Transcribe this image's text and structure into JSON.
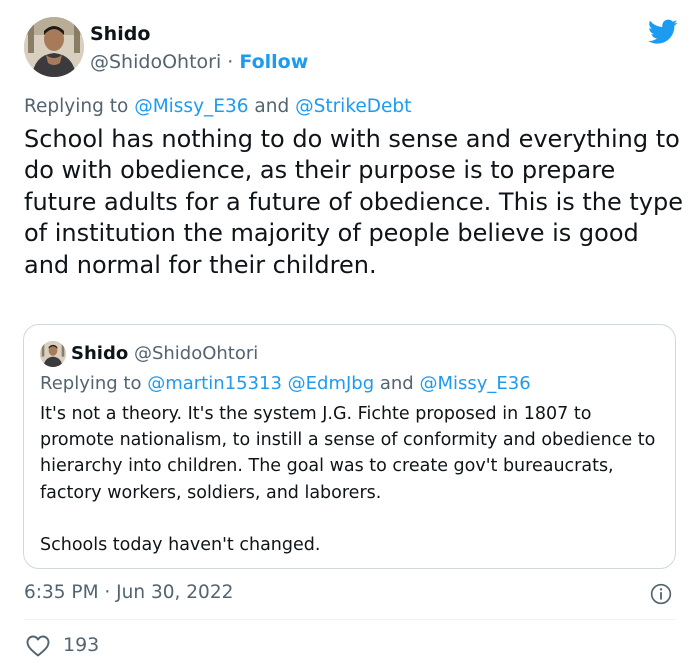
{
  "author": {
    "name": "Shido",
    "handle": "@ShidoOhtori",
    "separator": " · ",
    "follow_label": "Follow"
  },
  "reply": {
    "prefix": "Replying to ",
    "mention1": "@Missy_E36",
    "conjunction": " and ",
    "mention2": "@StrikeDebt"
  },
  "tweet": {
    "text": "School has nothing to do with sense and everything to do with obedience, as their purpose is to prepare future adults for a future of obedience. This is the type of institution the majority of people believe is good and normal for their children."
  },
  "quote": {
    "name": "Shido",
    "handle": "@ShidoOhtori",
    "reply_prefix": "Replying to ",
    "mention1": "@martin15313",
    "mention2": "@EdmJbg",
    "conjunction": " and ",
    "mention3": "@Missy_E36",
    "paragraph1": "It's not a theory. It's the system J.G. Fichte proposed in 1807 to promote nationalism, to instill a sense of conformity and obedience to hierarchy into children. The goal was to create gov't bureaucrats, factory workers, soldiers, and laborers.",
    "paragraph2": "Schools today haven't changed."
  },
  "meta": {
    "timestamp": "6:35 PM · Jun 30, 2022",
    "like_count": "193"
  },
  "icons": {
    "brand": "twitter-bird-icon",
    "info": "info-icon",
    "like": "heart-icon"
  },
  "colors": {
    "accent": "#1d9bf0",
    "secondary_text": "#536471",
    "primary_text": "#0f1419",
    "border": "#cfd9de"
  }
}
